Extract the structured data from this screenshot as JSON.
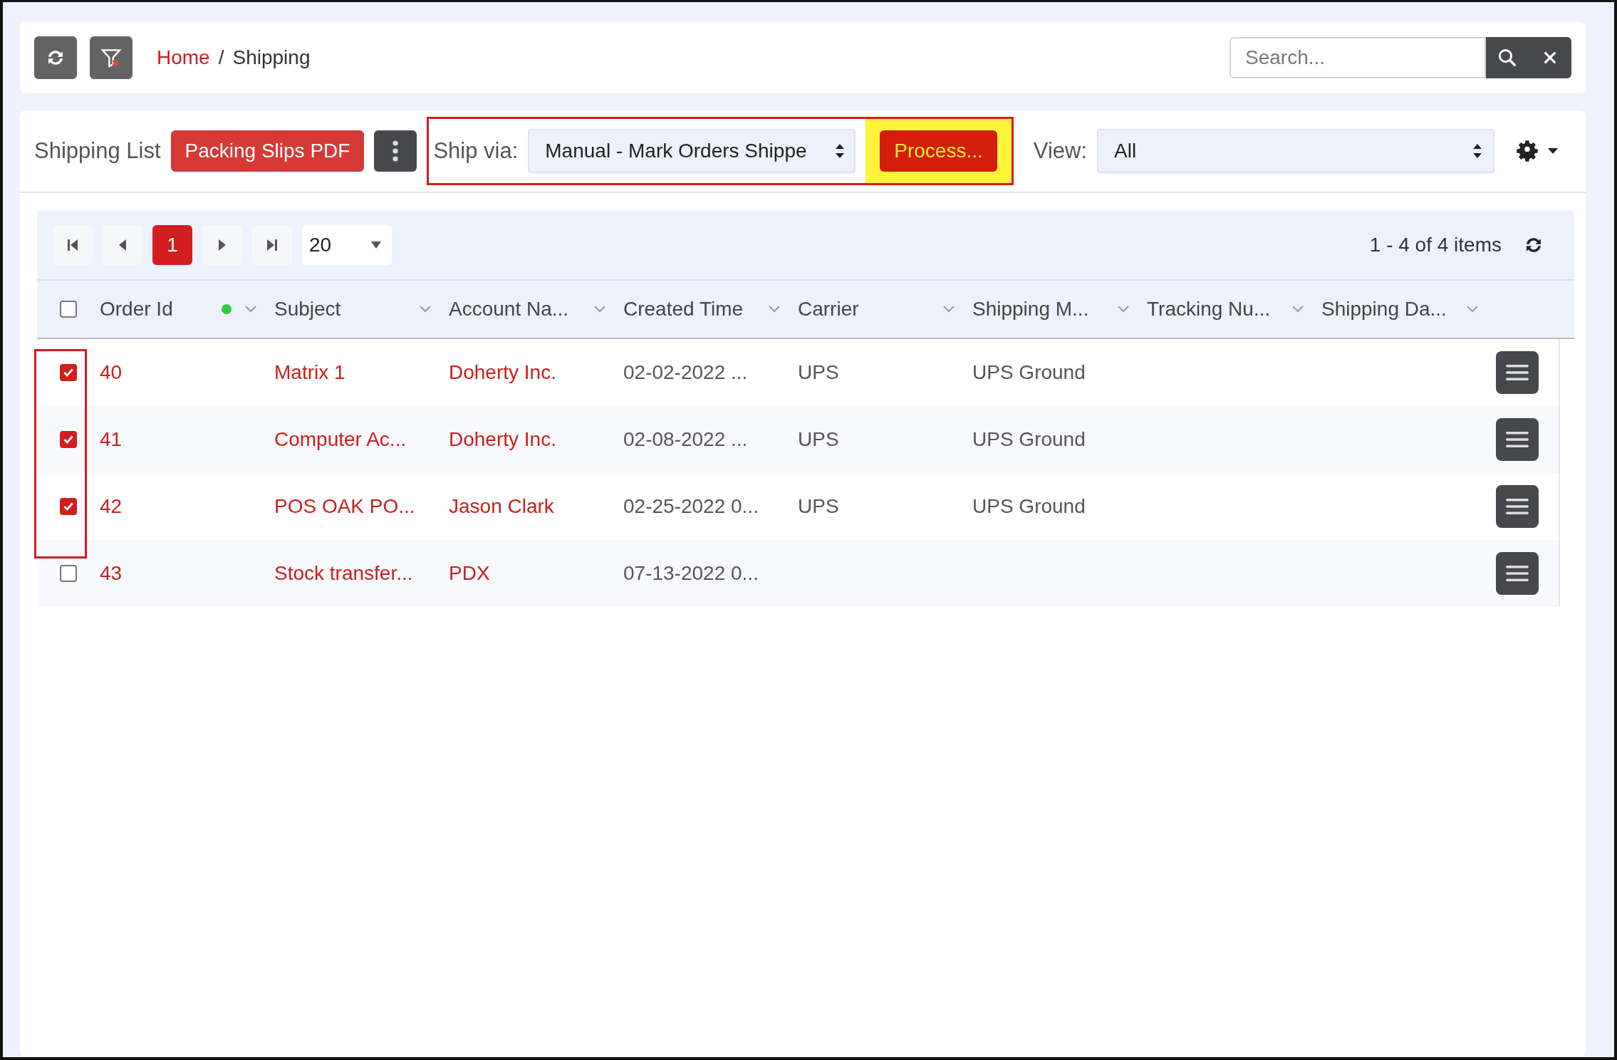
{
  "toolbar": {
    "breadcrumb": [
      {
        "label": "Home",
        "kind": "link"
      },
      {
        "label": "Shipping",
        "kind": "current"
      }
    ],
    "separator": "/",
    "search": {
      "placeholder": "Search..."
    }
  },
  "list_bar": {
    "title": "Shipping List",
    "pdf_button": "Packing Slips PDF",
    "ship_via": {
      "label": "Ship via:",
      "value": "Manual - Mark Orders Shippe",
      "highlighted": true
    },
    "process_button": {
      "label": "Process...",
      "highlighted": true
    },
    "view": {
      "label": "View:",
      "value": "All"
    }
  },
  "pager": {
    "pages": [
      {
        "label": "1",
        "selected": true
      }
    ],
    "page_size": "20",
    "summary": "1 - 4 of 4 items"
  },
  "table": {
    "select_all": {
      "checked": false
    },
    "checkbox_column_highlighted": true,
    "columns": [
      {
        "label": "Order Id",
        "kind": "link",
        "color": "#2ecc40"
      },
      {
        "label": "Subject",
        "kind": "link"
      },
      {
        "label": "Account Na...",
        "kind": "link"
      },
      {
        "label": "Created Time",
        "kind": "text"
      },
      {
        "label": "Carrier",
        "kind": "text"
      },
      {
        "label": "Shipping M...",
        "kind": "text"
      },
      {
        "label": "Tracking Nu..."
      },
      {
        "label": "Shipping Da..."
      }
    ],
    "rows": [
      {
        "checked": true,
        "cells": [
          "40",
          "Matrix 1",
          "Doherty Inc.",
          "02-02-2022 ...",
          "UPS",
          "UPS Ground"
        ]
      },
      {
        "checked": true,
        "cells": [
          "41",
          "Computer Ac...",
          "Doherty Inc.",
          "02-08-2022 ...",
          "UPS",
          "UPS Ground"
        ]
      },
      {
        "checked": true,
        "cells": [
          "42",
          "POS OAK PO...",
          "Jason Clark",
          "02-25-2022 0...",
          "UPS",
          "UPS Ground"
        ]
      },
      {
        "checked": false,
        "cells": [
          "43",
          "Stock transfer...",
          "PDX",
          "07-13-2022 0..."
        ]
      }
    ]
  }
}
